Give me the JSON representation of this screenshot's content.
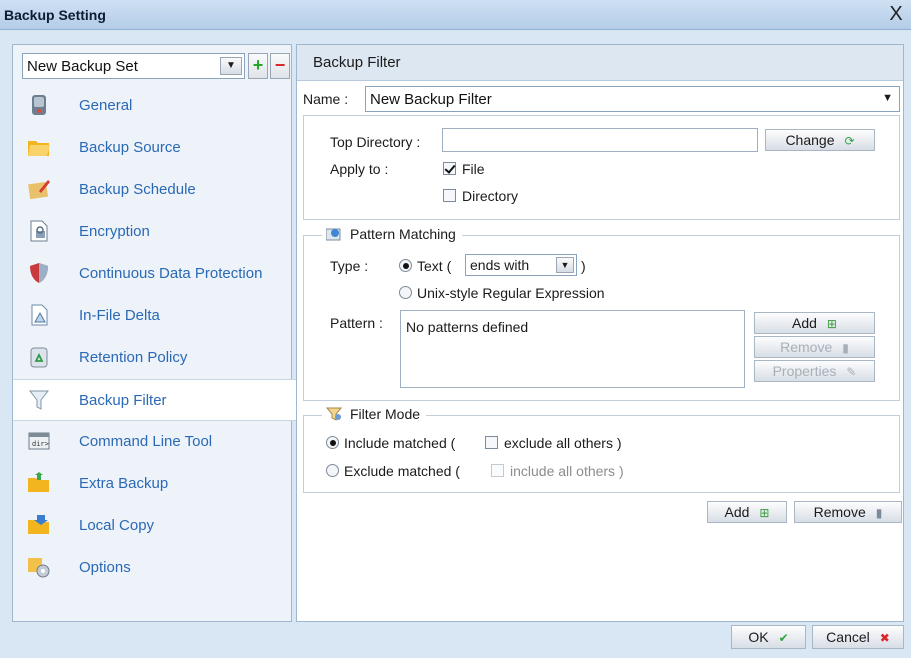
{
  "window": {
    "title": "Backup Setting",
    "close_glyph": "X"
  },
  "sidebar": {
    "backup_set": "New Backup Set",
    "add_glyph": "+",
    "remove_glyph": "−",
    "items": [
      {
        "label": "General",
        "icon": "general-icon"
      },
      {
        "label": "Backup Source",
        "icon": "folder-icon"
      },
      {
        "label": "Backup Schedule",
        "icon": "schedule-icon"
      },
      {
        "label": "Encryption",
        "icon": "encryption-icon"
      },
      {
        "label": "Continuous Data Protection",
        "icon": "shield-icon"
      },
      {
        "label": "In-File Delta",
        "icon": "delta-icon"
      },
      {
        "label": "Retention Policy",
        "icon": "recycle-icon"
      },
      {
        "label": "Backup Filter",
        "icon": "filter-icon"
      },
      {
        "label": "Command Line Tool",
        "icon": "terminal-icon"
      },
      {
        "label": "Extra Backup",
        "icon": "extra-backup-icon"
      },
      {
        "label": "Local Copy",
        "icon": "local-copy-icon"
      },
      {
        "label": "Options",
        "icon": "options-icon"
      }
    ],
    "active_item": "Backup Filter"
  },
  "panel": {
    "header": "Backup Filter",
    "name_label": "Name :",
    "name_value": "New Backup Filter",
    "top_directory_label": "Top Directory :",
    "top_directory_value": "",
    "change_button": "Change",
    "apply_to_label": "Apply to :",
    "apply_file": {
      "label": "File",
      "checked": true
    },
    "apply_directory": {
      "label": "Directory",
      "checked": false
    },
    "pattern_matching": {
      "legend": "Pattern Matching",
      "type_label": "Type :",
      "text_option_prefix": "Text (",
      "text_option_suffix": ")",
      "text_mode_value": "ends with",
      "regex_option": "Unix-style Regular Expression",
      "selected": "text",
      "pattern_label": "Pattern :",
      "patterns_placeholder": "No patterns defined",
      "add_button": "Add",
      "remove_button": "Remove",
      "properties_button": "Properties"
    },
    "filter_mode": {
      "legend": "Filter Mode",
      "include_label": "Include matched (",
      "include_check_label": "exclude all others )",
      "exclude_label": "Exclude matched (",
      "exclude_check_label": "include all others )",
      "selected": "include"
    },
    "add_button": "Add",
    "remove_button": "Remove"
  },
  "footer": {
    "ok_button": "OK",
    "cancel_button": "Cancel"
  },
  "colors": {
    "link_blue": "#2a69b5",
    "ok_green": "#2fa640",
    "cancel_red": "#d8252a",
    "frame_blue": "#d9e6f4"
  }
}
